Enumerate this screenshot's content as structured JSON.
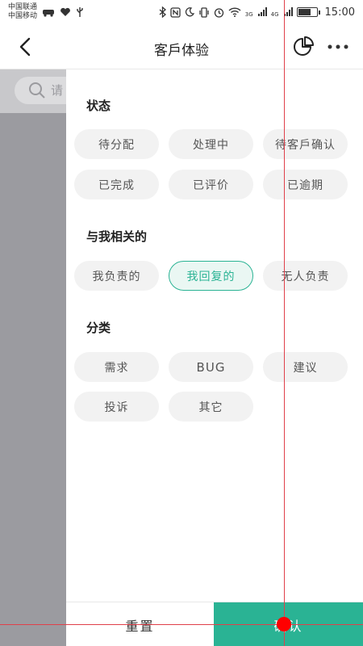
{
  "status_bar": {
    "carrier_1": "中国联通",
    "carrier_2": "中国移动",
    "network_1": "3G",
    "network_2": "4G",
    "time": "15:00",
    "battery_fraction": 0.7,
    "icons": [
      "car-icon",
      "heart-icon",
      "usb-icon",
      "bluetooth-icon",
      "nfc-icon",
      "moon-icon",
      "vibrate-icon",
      "alarm-icon",
      "wifi-icon",
      "signal-icon",
      "battery-icon"
    ]
  },
  "header": {
    "title": "客戶体验",
    "back_icon": "chevron-left-icon",
    "chart_icon": "pie-chart-icon",
    "more_icon": "more-horizontal-icon"
  },
  "backdrop": {
    "search_hint": "请"
  },
  "filters": {
    "status": {
      "title": "状态",
      "options": [
        "待分配",
        "处理中",
        "待客戶确认",
        "已完成",
        "已评价",
        "已逾期"
      ]
    },
    "related": {
      "title": "与我相关的",
      "options": [
        "我负责的",
        "我回复的",
        "无人负责"
      ],
      "selected": "我回复的"
    },
    "category": {
      "title": "分类",
      "options": [
        "需求",
        "BUG",
        "建议",
        "投诉",
        "其它"
      ]
    }
  },
  "actions": {
    "reset_label": "重置",
    "confirm_label": "确认"
  },
  "colors": {
    "accent": "#2ab394",
    "chip_bg": "#f2f2f2",
    "backdrop": "#9b9ba0",
    "guide": "#e0404a"
  }
}
